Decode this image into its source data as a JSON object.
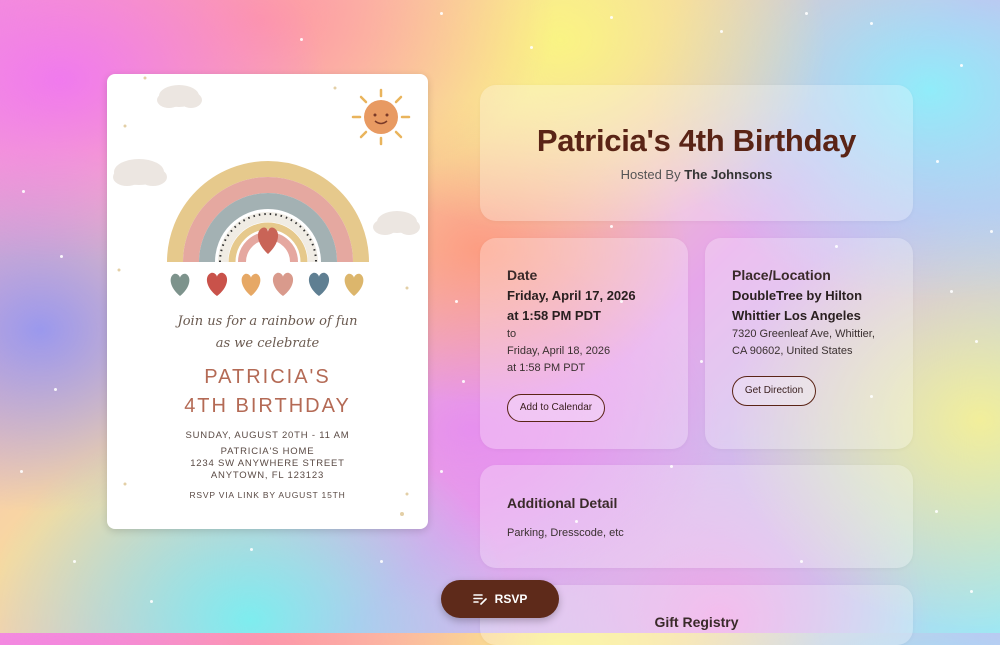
{
  "event": {
    "title": "Patricia's 4th Birthday",
    "hosted_prefix": "Hosted By",
    "host": "The Johnsons"
  },
  "date_card": {
    "label": "Date",
    "start_date": "Friday, April 17, 2026",
    "start_time": "at 1:58 PM PDT",
    "to": "to",
    "end_date": "Friday, April 18, 2026",
    "end_time": "at 1:58 PM PDT",
    "button": "Add to Calendar"
  },
  "location_card": {
    "label": "Place/Location",
    "name_line1": "DoubleTree by Hilton",
    "name_line2": "Whittier Los Angeles",
    "address_line1": "7320 Greenleaf Ave, Whittier,",
    "address_line2": "CA 90602, United States",
    "button": "Get Direction"
  },
  "details_card": {
    "label": "Additional Detail",
    "text": "Parking, Dresscode, etc"
  },
  "registry_card": {
    "label": "Gift Registry"
  },
  "rsvp_button": {
    "label": "RSVP",
    "icon": "list-edit-icon"
  },
  "invitation": {
    "line1": "Join us for a rainbow of fun",
    "line2": "as we celebrate",
    "name": "PATRICIA'S",
    "occasion": "4TH BIRTHDAY",
    "when": "SUNDAY, AUGUST 20TH - 11 AM",
    "place": "PATRICIA'S HOME",
    "street": "1234 SW ANYWHERE STREET",
    "city": "ANYTOWN, FL 123123",
    "rsvp": "RSVP VIA LINK BY AUGUST 15TH"
  },
  "colors": {
    "accent": "#5e2a1a",
    "title": "#5a2416"
  }
}
